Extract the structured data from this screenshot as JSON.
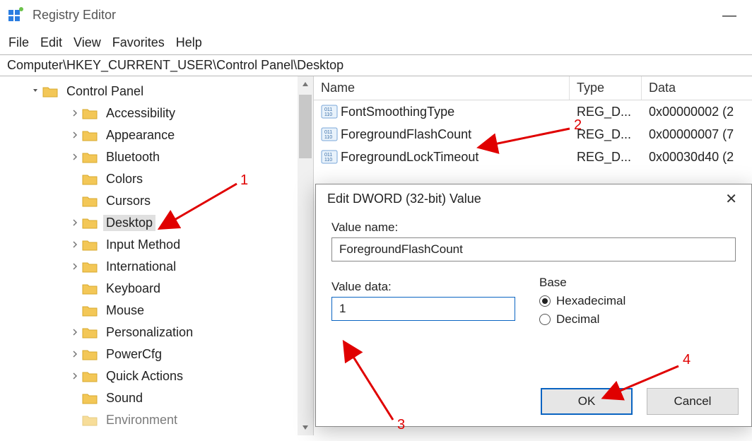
{
  "app": {
    "title": "Registry Editor",
    "window_controls": {
      "minimize": "—"
    }
  },
  "menu": {
    "file": "File",
    "edit": "Edit",
    "view": "View",
    "favorites": "Favorites",
    "help": "Help"
  },
  "address": "Computer\\HKEY_CURRENT_USER\\Control Panel\\Desktop",
  "tree": {
    "root": "Control Panel",
    "items": [
      {
        "label": "Accessibility",
        "expandable": true
      },
      {
        "label": "Appearance",
        "expandable": true
      },
      {
        "label": "Bluetooth",
        "expandable": true
      },
      {
        "label": "Colors",
        "expandable": false
      },
      {
        "label": "Cursors",
        "expandable": false
      },
      {
        "label": "Desktop",
        "expandable": true,
        "selected": true
      },
      {
        "label": "Input Method",
        "expandable": true
      },
      {
        "label": "International",
        "expandable": true
      },
      {
        "label": "Keyboard",
        "expandable": false
      },
      {
        "label": "Mouse",
        "expandable": false
      },
      {
        "label": "Personalization",
        "expandable": true
      },
      {
        "label": "PowerCfg",
        "expandable": true
      },
      {
        "label": "Quick Actions",
        "expandable": true
      },
      {
        "label": "Sound",
        "expandable": false
      },
      {
        "label": "Environment",
        "expandable": false,
        "faded": true
      }
    ]
  },
  "list": {
    "headers": {
      "name": "Name",
      "type": "Type",
      "data": "Data"
    },
    "rows": [
      {
        "name": "FontSmoothingType",
        "type": "REG_D...",
        "data": "0x00000002 (2"
      },
      {
        "name": "ForegroundFlashCount",
        "type": "REG_D...",
        "data": "0x00000007 (7"
      },
      {
        "name": "ForegroundLockTimeout",
        "type": "REG_D...",
        "data": "0x00030d40 (2"
      }
    ]
  },
  "dialog": {
    "title": "Edit DWORD (32-bit) Value",
    "value_name_label": "Value name:",
    "value_name": "ForegroundFlashCount",
    "value_data_label": "Value data:",
    "value_data": "1",
    "base_label": "Base",
    "radio_hex": "Hexadecimal",
    "radio_dec": "Decimal",
    "ok": "OK",
    "cancel": "Cancel"
  },
  "annotations": {
    "n1": "1",
    "n2": "2",
    "n3": "3",
    "n4": "4"
  }
}
